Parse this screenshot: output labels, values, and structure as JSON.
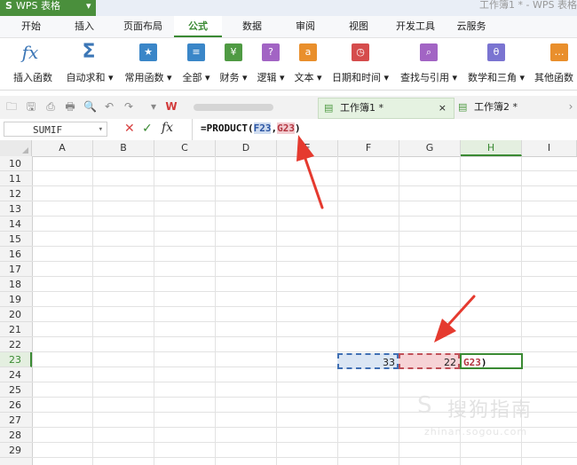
{
  "title_bar": {
    "app_name": "WPS 表格",
    "app_logo": "S",
    "app_menu_arrow": "▾",
    "window_title": "工作簿1 * - WPS 表格"
  },
  "tabs": [
    "开始",
    "插入",
    "页面布局",
    "公式",
    "数据",
    "审阅",
    "视图",
    "开发工具",
    "云服务"
  ],
  "active_tab_index": 3,
  "ribbon": {
    "buttons": [
      {
        "label": "插入函数",
        "icon": "fx-icon",
        "glyph": "fx",
        "color": "#3b76b6"
      },
      {
        "label": "自动求和 ▾",
        "icon": "sigma-icon",
        "glyph": "Σ",
        "color": "#3b76b6"
      },
      {
        "label": "常用函数 ▾",
        "icon": "star-book-icon",
        "glyph": "★",
        "color": "#3a86c8"
      },
      {
        "label": "全部 ▾",
        "icon": "list-book-icon",
        "glyph": "≡",
        "color": "#3a86c8"
      },
      {
        "label": "财务 ▾",
        "icon": "finance-book-icon",
        "glyph": "¥",
        "color": "#4f9a43"
      },
      {
        "label": "逻辑 ▾",
        "icon": "logic-book-icon",
        "glyph": "?",
        "color": "#a264c4"
      },
      {
        "label": "文本 ▾",
        "icon": "text-book-icon",
        "glyph": "a",
        "color": "#e98f2c"
      },
      {
        "label": "日期和时间 ▾",
        "icon": "clock-book-icon",
        "glyph": "◷",
        "color": "#d54c4c"
      },
      {
        "label": "查找与引用 ▾",
        "icon": "search-book-icon",
        "glyph": "⌕",
        "color": "#a264c4"
      },
      {
        "label": "数学和三角 ▾",
        "icon": "math-book-icon",
        "glyph": "θ",
        "color": "#7a74d1"
      },
      {
        "label": "其他函数",
        "icon": "more-book-icon",
        "glyph": "…",
        "color": "#e98f2c"
      }
    ]
  },
  "quick_access": {
    "icons": [
      "folder-icon",
      "save-icon",
      "print-preview-icon",
      "print-icon",
      "preview-icon",
      "undo-icon",
      "redo-icon",
      "dropdown-icon"
    ],
    "glyphs": [
      "🗀",
      "🖫",
      "⎙",
      "🖶",
      "🔍",
      "↶",
      "↷",
      "▾"
    ],
    "wps_mark": "W",
    "doc_tabs": [
      {
        "label": "工作簿1 *",
        "close": "×"
      },
      {
        "label": "工作簿2 *"
      }
    ],
    "overflow": "›"
  },
  "formula_bar": {
    "name_box": "SUMIF",
    "name_box_arrow": "▾",
    "cancel": "✕",
    "confirm": "✓",
    "fx": "fx",
    "formula_prefix": "=PRODUCT(",
    "ref1": "F23",
    "sep": ",",
    "ref2": "G23",
    "formula_suffix": ")"
  },
  "grid": {
    "columns": [
      "A",
      "B",
      "C",
      "D",
      "E",
      "F",
      "G",
      "H",
      "I"
    ],
    "rows": [
      "10",
      "11",
      "12",
      "13",
      "14",
      "15",
      "16",
      "17",
      "18",
      "19",
      "20",
      "21",
      "22",
      "23",
      "24",
      "25",
      "26",
      "27",
      "28",
      "29"
    ],
    "selected_column": "H",
    "selected_row": "23",
    "cells": {
      "F23": "33",
      "G23": "22",
      "H23_ref": "G23",
      "H23_suffix": ")"
    }
  },
  "watermark": {
    "logo": "S",
    "text": "搜狗指南",
    "url": "zhinan.sogou.com"
  },
  "colors": {
    "accent_green": "#3a8a33",
    "ref1_blue": "#3f6fb3",
    "ref2_red": "#c05058",
    "arrow_red": "#e53a2f"
  }
}
